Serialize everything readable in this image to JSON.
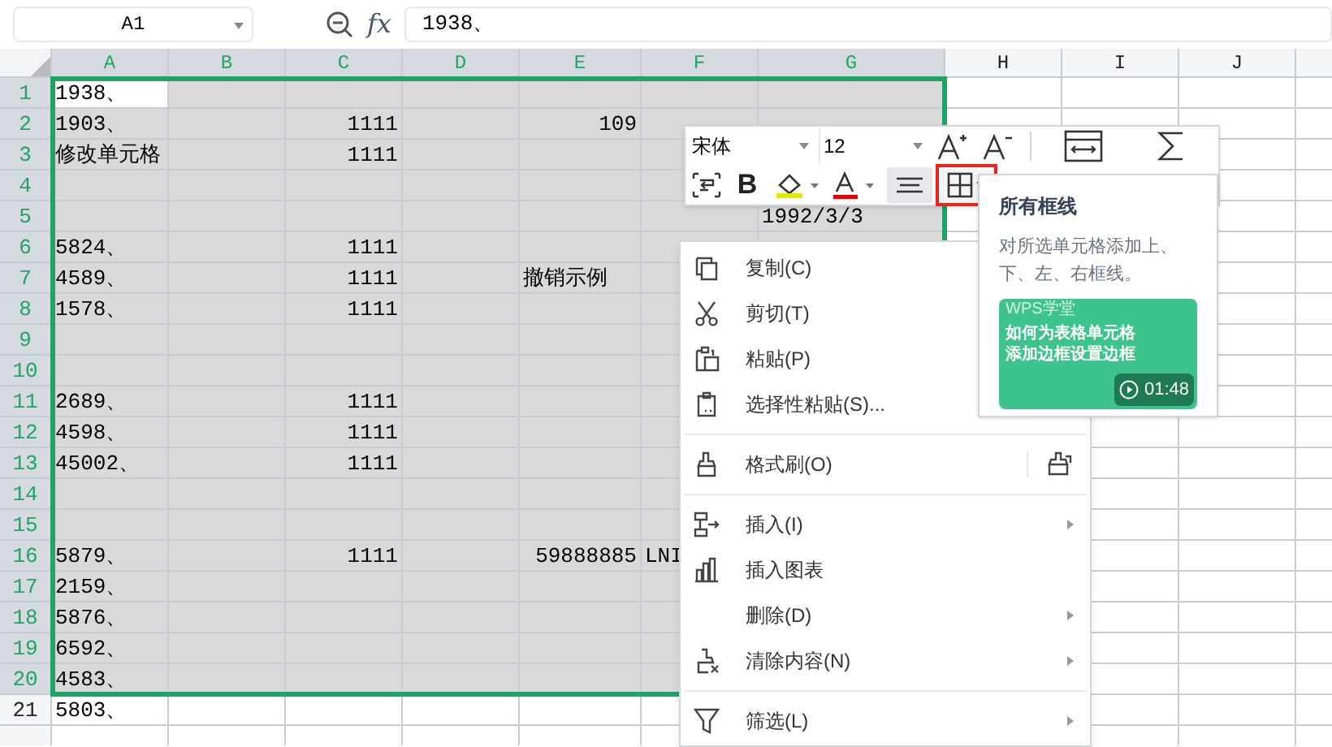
{
  "formula_bar": {
    "name_box": "A1",
    "fx_label": "fx",
    "formula": "1938、"
  },
  "columns": [
    {
      "label": "A",
      "selected": true
    },
    {
      "label": "B",
      "selected": true
    },
    {
      "label": "C",
      "selected": true
    },
    {
      "label": "D",
      "selected": true
    },
    {
      "label": "E",
      "selected": true
    },
    {
      "label": "F",
      "selected": true
    },
    {
      "label": "G",
      "selected": true
    },
    {
      "label": "H",
      "selected": false
    },
    {
      "label": "I",
      "selected": false
    },
    {
      "label": "J",
      "selected": false
    }
  ],
  "rows": [
    {
      "number": "1",
      "selected": true,
      "cells": {
        "A": "1938、"
      }
    },
    {
      "number": "2",
      "selected": true,
      "cells": {
        "A": "1903、",
        "C": "1111",
        "E": "109"
      }
    },
    {
      "number": "3",
      "selected": true,
      "cells": {
        "A": "修改单元格",
        "C": "1111"
      }
    },
    {
      "number": "4",
      "selected": true,
      "cells": {}
    },
    {
      "number": "5",
      "selected": true,
      "cells": {
        "G": "1992/3/3"
      }
    },
    {
      "number": "6",
      "selected": true,
      "cells": {
        "A": "5824、",
        "C": "1111"
      }
    },
    {
      "number": "7",
      "selected": true,
      "cells": {
        "A": "4589、",
        "C": "1111",
        "E": "撤销示例"
      }
    },
    {
      "number": "8",
      "selected": true,
      "cells": {
        "A": "1578、",
        "C": "1111"
      }
    },
    {
      "number": "9",
      "selected": true,
      "cells": {}
    },
    {
      "number": "10",
      "selected": true,
      "cells": {}
    },
    {
      "number": "11",
      "selected": true,
      "cells": {
        "A": "2689、",
        "C": "1111"
      }
    },
    {
      "number": "12",
      "selected": true,
      "cells": {
        "A": "4598、",
        "C": "1111"
      }
    },
    {
      "number": "13",
      "selected": true,
      "cells": {
        "A": "45002、",
        "C": "1111"
      }
    },
    {
      "number": "14",
      "selected": true,
      "cells": {}
    },
    {
      "number": "15",
      "selected": true,
      "cells": {}
    },
    {
      "number": "16",
      "selected": true,
      "cells": {
        "A": "5879、",
        "C": "1111",
        "E": "59888885",
        "F": "LNI"
      }
    },
    {
      "number": "17",
      "selected": true,
      "cells": {
        "A": "2159、"
      }
    },
    {
      "number": "18",
      "selected": true,
      "cells": {
        "A": "5876、"
      }
    },
    {
      "number": "19",
      "selected": true,
      "cells": {
        "A": "6592、"
      }
    },
    {
      "number": "20",
      "selected": true,
      "cells": {
        "A": "4583、"
      }
    },
    {
      "number": "21",
      "selected": false,
      "cells": {
        "A": "5803、"
      }
    }
  ],
  "mini_toolbar": {
    "font": "宋体",
    "size": "12",
    "bold_label": "B",
    "border_button_highlighted": true
  },
  "tooltip": {
    "title": "所有框线",
    "description": "对所选单元格添加上、下、左、右框线。",
    "video": {
      "brand": "WPS学堂",
      "title": "如何为表格单元格添加边框设置边框",
      "duration": "01:48"
    }
  },
  "context_menu": [
    {
      "kind": "item",
      "label": "复制(C)",
      "submenu": false
    },
    {
      "kind": "item",
      "label": "剪切(T)",
      "submenu": false
    },
    {
      "kind": "item",
      "label": "粘贴(P)",
      "submenu": false
    },
    {
      "kind": "item",
      "label": "选择性粘贴(S)...",
      "submenu": false
    },
    {
      "kind": "separator"
    },
    {
      "kind": "item",
      "label": "格式刷(O)",
      "submenu": false,
      "extra_icon": true
    },
    {
      "kind": "separator"
    },
    {
      "kind": "item",
      "label": "插入(I)",
      "submenu": true
    },
    {
      "kind": "item",
      "label": "插入图表",
      "submenu": false
    },
    {
      "kind": "item",
      "label": "删除(D)",
      "submenu": true
    },
    {
      "kind": "item",
      "label": "清除内容(N)",
      "submenu": true
    },
    {
      "kind": "separator"
    },
    {
      "kind": "item",
      "label": "筛选(L)",
      "submenu": true
    }
  ]
}
